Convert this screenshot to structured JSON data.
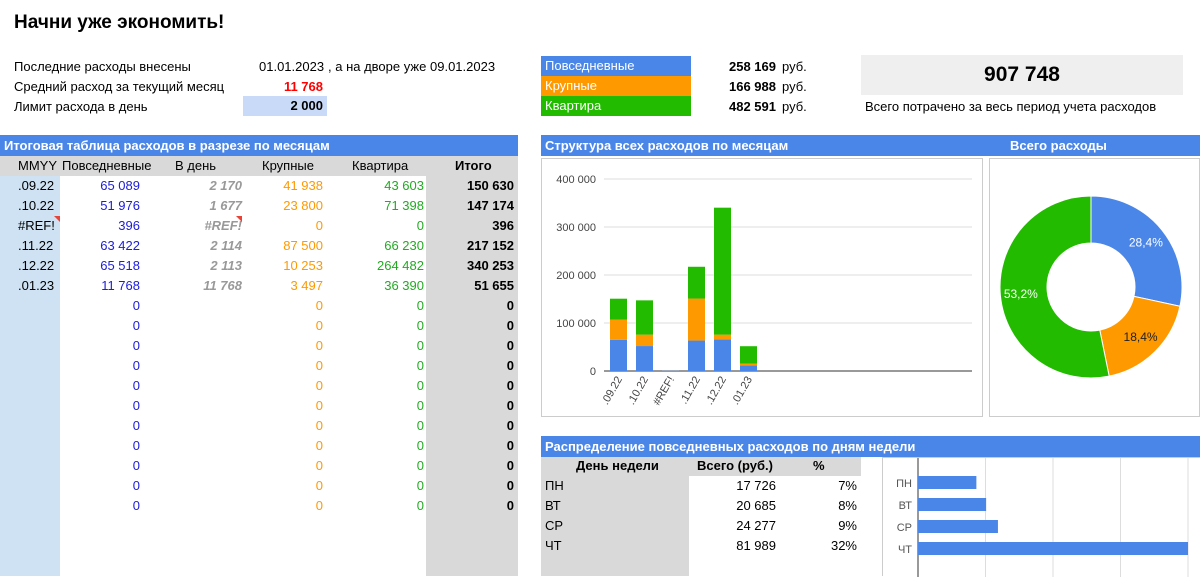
{
  "title": "Начни уже экономить!",
  "info": {
    "last_label": "Последние расходы внесены",
    "last_date": "01.01.2023",
    "now_label": ", а на дворе уже",
    "now_date": "09.01.2023",
    "avg_label": "Средний расход за текущий месяц",
    "avg_value": "11 768",
    "limit_label": "Лимит расхода в день",
    "limit_value": "2 000"
  },
  "legend": [
    {
      "name": "Повседневные",
      "value": "258 169",
      "unit": "руб.",
      "color": "#4a86e8"
    },
    {
      "name": "Крупные",
      "value": "166 988",
      "unit": "руб.",
      "color": "#ff9900"
    },
    {
      "name": "Квартира",
      "value": "482 591",
      "unit": "руб.",
      "color": "#22bb00"
    }
  ],
  "total": {
    "value": "907 748",
    "caption": "Всего потрачено за весь период учета расходов"
  },
  "monthly": {
    "header": "Итоговая таблица расходов в разрезе по месяцам",
    "columns": [
      "MMYY",
      "Повседневные",
      "В день",
      "Крупные",
      "Квартира",
      "Итого"
    ],
    "rows": [
      [
        ".09.22",
        "65 089",
        "2 170",
        "41 938",
        "43 603",
        "150 630"
      ],
      [
        ".10.22",
        "51 976",
        "1 677",
        "23 800",
        "71 398",
        "147 174"
      ],
      [
        "#REF!",
        "396",
        "#REF!",
        "0",
        "0",
        "396"
      ],
      [
        ".11.22",
        "63 422",
        "2 114",
        "87 500",
        "66 230",
        "217 152"
      ],
      [
        ".12.22",
        "65 518",
        "2 113",
        "10 253",
        "264 482",
        "340 253"
      ],
      [
        ".01.23",
        "11 768",
        "11 768",
        "3 497",
        "36 390",
        "51 655"
      ],
      [
        "",
        "0",
        "",
        "0",
        "0",
        "0"
      ],
      [
        "",
        "0",
        "",
        "0",
        "0",
        "0"
      ],
      [
        "",
        "0",
        "",
        "0",
        "0",
        "0"
      ],
      [
        "",
        "0",
        "",
        "0",
        "0",
        "0"
      ],
      [
        "",
        "0",
        "",
        "0",
        "0",
        "0"
      ],
      [
        "",
        "0",
        "",
        "0",
        "0",
        "0"
      ],
      [
        "",
        "0",
        "",
        "0",
        "0",
        "0"
      ],
      [
        "",
        "0",
        "",
        "0",
        "0",
        "0"
      ],
      [
        "",
        "0",
        "",
        "0",
        "0",
        "0"
      ],
      [
        "",
        "0",
        "",
        "0",
        "0",
        "0"
      ],
      [
        "",
        "0",
        "",
        "0",
        "0",
        "0"
      ]
    ]
  },
  "structure_header": "Структура всех расходов по месяцам",
  "total_header": "Всего расходы",
  "weekday": {
    "header": "Распределение повседневных расходов по дням недели",
    "columns": [
      "День недели",
      "Всего (руб.)",
      "%"
    ],
    "rows": [
      [
        "ПН",
        "17 726",
        "7%"
      ],
      [
        "ВТ",
        "20 685",
        "8%"
      ],
      [
        "СР",
        "24 277",
        "9%"
      ],
      [
        "ЧТ",
        "81 989",
        "32%"
      ]
    ]
  },
  "chart_data": [
    {
      "type": "bar",
      "stacked": true,
      "categories": [
        ".09.22",
        ".10.22",
        "#REF!",
        ".11.22",
        ".12.22",
        ".01.23"
      ],
      "series": [
        {
          "name": "Повседневные",
          "values": [
            65089,
            51976,
            396,
            63422,
            65518,
            11768
          ],
          "color": "#4a86e8"
        },
        {
          "name": "Крупные",
          "values": [
            41938,
            23800,
            0,
            87500,
            10253,
            3497
          ],
          "color": "#ff9900"
        },
        {
          "name": "Квартира",
          "values": [
            43603,
            71398,
            0,
            66230,
            264482,
            36390
          ],
          "color": "#22bb00"
        }
      ],
      "yticks": [
        "0",
        "100 000",
        "200 000",
        "300 000",
        "400 000"
      ],
      "ylim": [
        0,
        400000
      ],
      "grid": true
    },
    {
      "type": "pie",
      "donut": true,
      "labels": [
        "Повседневные",
        "Крупные",
        "Квартира"
      ],
      "values": [
        28.4,
        18.4,
        53.2
      ],
      "display": [
        "28,4%",
        "18,4%",
        "53,2%"
      ],
      "colors": [
        "#4a86e8",
        "#ff9900",
        "#22bb00"
      ]
    },
    {
      "type": "bar",
      "orientation": "horizontal",
      "categories": [
        "ПН",
        "ВТ",
        "СР",
        "ЧТ"
      ],
      "values": [
        17726,
        20685,
        24277,
        81989
      ],
      "color": "#4a86e8",
      "grid": true
    }
  ]
}
